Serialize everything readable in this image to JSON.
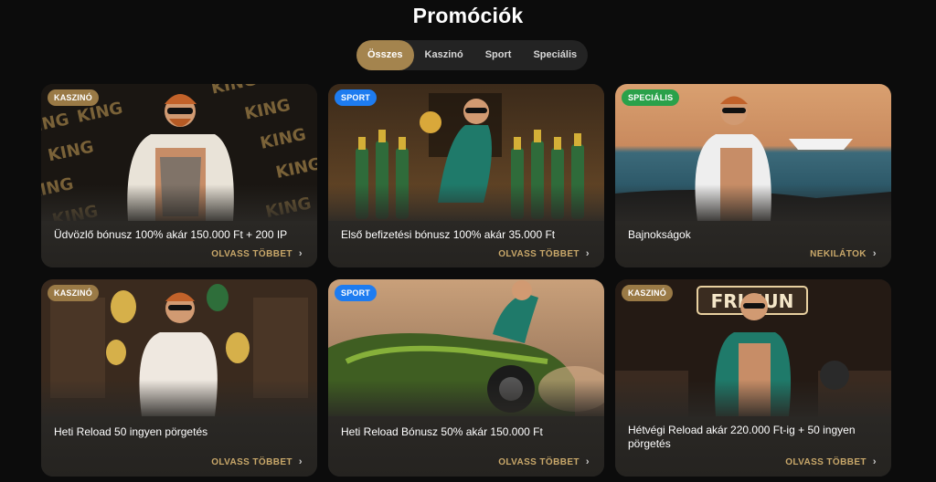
{
  "page": {
    "title": "Promóciók"
  },
  "tabs": [
    {
      "label": "Összes",
      "active": true
    },
    {
      "label": "Kaszinó",
      "active": false
    },
    {
      "label": "Sport",
      "active": false
    },
    {
      "label": "Speciális",
      "active": false
    }
  ],
  "cards": [
    {
      "badge": "KASZINÓ",
      "title": "Üdvözlő bónusz 100% akár 150.000 Ft + 200 IP",
      "cta": "OLVASS TÖBBET"
    },
    {
      "badge": "SPORT",
      "title": "Első befizetési bónusz 100% akár 35.000 Ft",
      "cta": "OLVASS TÖBBET"
    },
    {
      "badge": "SPECIÁLIS",
      "title": "Bajnokságok",
      "cta": "NEKILÁTOK"
    },
    {
      "badge": "KASZINÓ",
      "title": "Heti Reload 50 ingyen pörgetés",
      "cta": "OLVASS TÖBBET"
    },
    {
      "badge": "SPORT",
      "title": "Heti Reload Bónusz 50% akár 150.000 Ft",
      "cta": "OLVASS TÖBBET"
    },
    {
      "badge": "KASZINÓ",
      "title": "Hétvégi Reload akár 220.000 Ft-ig + 50 ingyen pörgetés",
      "cta": "OLVASS TÖBBET"
    }
  ],
  "image_text": {
    "king": "KING",
    "sign": "FRI SUN"
  },
  "colors": {
    "accent_gold": "#a4844e",
    "cta_gold": "#c9a86a",
    "badge_sport": "#1e7cf0",
    "badge_special": "#2aa14a",
    "badge_casino": "#9a7a46"
  },
  "icons": {
    "cta_arrow": "chevron-right-icon"
  }
}
